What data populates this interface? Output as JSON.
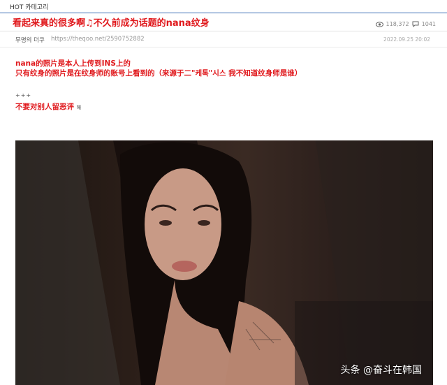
{
  "category_bar": {
    "tab_label": "HOT 카테고리"
  },
  "post": {
    "title": "看起来真的很多啊♫不久前成为话题的nana纹身",
    "views": "118,372",
    "comments": "1041",
    "author": "무명의 더쿠",
    "link": "https://theqoo.net/2590752882",
    "date": "2022.09.25 20:02"
  },
  "body": {
    "line1": "nana的照片是本人上传到INS上的",
    "line2": "只有纹身的照片是在纹身师的账号上看到的（来源于二\"케톡\"시스 我不知道纹身师是谁）",
    "plus_marks": "+++",
    "warning": "不要对别人留恶评",
    "warning_suffix": "해"
  },
  "photo": {
    "watermark": "头条 @奋斗在韩国"
  },
  "icons": {
    "views": "eye-icon",
    "comments": "speech-bubble-icon"
  },
  "colors": {
    "accent_red": "#e0191d",
    "category_line": "#3b6fb6"
  }
}
